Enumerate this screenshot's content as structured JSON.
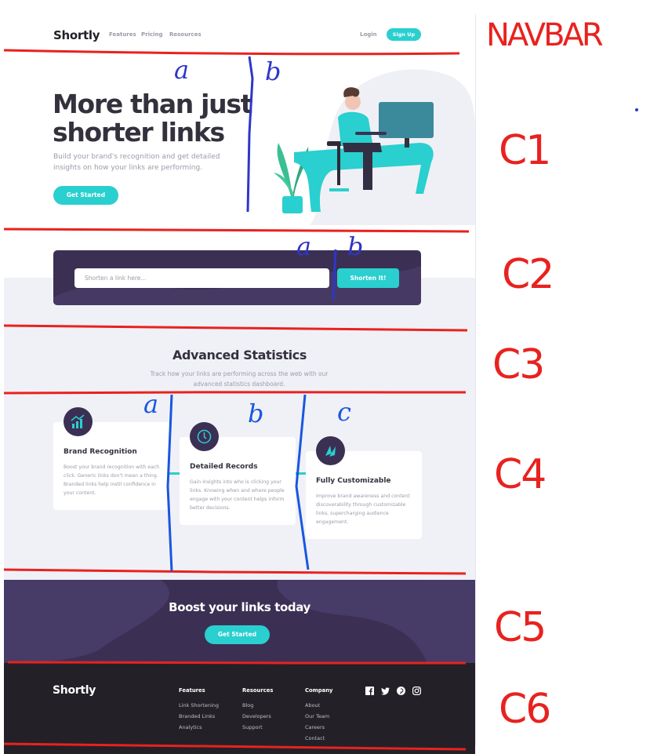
{
  "navbar": {
    "logo": "Shortly",
    "links": [
      "Features",
      "Pricing",
      "Resources"
    ],
    "login": "Login",
    "signup": "Sign Up"
  },
  "hero": {
    "title": "More than just shorter links",
    "subtitle": "Build your brand's recognition and get detailed insights on how your links are performing.",
    "cta": "Get Started"
  },
  "shorten": {
    "placeholder": "Shorten a link here...",
    "button": "Shorten It!"
  },
  "stats": {
    "title": "Advanced Statistics",
    "subtitle": "Track how your links are performing across the web with our advanced statistics dashboard.",
    "cards": [
      {
        "icon": "brand-recognition-icon",
        "title": "Brand Recognition",
        "text": "Boost your brand recognition with each click. Generic links don't mean a thing. Branded links help instil confidence in your content."
      },
      {
        "icon": "detailed-records-icon",
        "title": "Detailed Records",
        "text": "Gain insights into who is clicking your links. Knowing when and where people engage with your content helps inform better decisions."
      },
      {
        "icon": "fully-customizable-icon",
        "title": "Fully Customizable",
        "text": "Improve brand awareness and content discoverability through customizable links, supercharging audience engagement."
      }
    ]
  },
  "boost": {
    "title": "Boost your links today",
    "cta": "Get Started"
  },
  "footer": {
    "logo": "Shortly",
    "columns": [
      {
        "heading": "Features",
        "links": [
          "Link Shortening",
          "Branded Links",
          "Analytics"
        ]
      },
      {
        "heading": "Resources",
        "links": [
          "Blog",
          "Developers",
          "Support"
        ]
      },
      {
        "heading": "Company",
        "links": [
          "About",
          "Our Team",
          "Careers",
          "Contact"
        ]
      }
    ],
    "social": [
      "facebook-icon",
      "twitter-icon",
      "pinterest-icon",
      "instagram-icon"
    ]
  },
  "annotations": {
    "navbar": "NAVBAR",
    "sections": [
      "C1",
      "C2",
      "C3",
      "C4",
      "C5",
      "C6"
    ],
    "c1_columns": [
      "a",
      "b"
    ],
    "c2_columns": [
      "a",
      "b"
    ],
    "c4_columns": [
      "a",
      "b",
      "c"
    ]
  },
  "colors": {
    "cyan": "#2acfcf",
    "dark_violet": "#3b3054",
    "very_dark": "#232127",
    "gray_bg": "#f0f1f6",
    "annotation_red": "#e8221f",
    "annotation_blue": "#2f36c7"
  }
}
